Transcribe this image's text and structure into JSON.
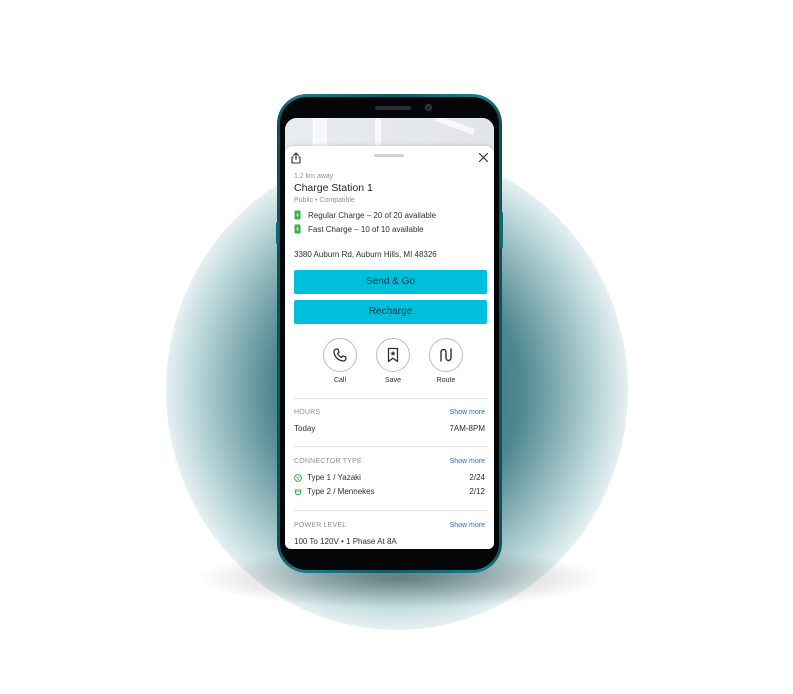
{
  "station": {
    "distance": "1.2 km away",
    "name": "Charge Station 1",
    "meta": "Public • Compatible",
    "availability": [
      {
        "label": "Regular Charge – 20 of 20 available"
      },
      {
        "label": "Fast Charge – 10 of 10 available"
      }
    ],
    "address": "3380 Auburn Rd, Auburn Hills, MI 48326"
  },
  "buttons": {
    "primary": "Send & Go",
    "secondary": "Recharge"
  },
  "actions": [
    {
      "label": "Call",
      "icon": "phone-icon"
    },
    {
      "label": "Save",
      "icon": "bookmark-star-icon"
    },
    {
      "label": "Route",
      "icon": "route-icon"
    }
  ],
  "hours": {
    "label": "HOURS",
    "show_more": "Show more",
    "day": "Today",
    "time": "7AM-8PM"
  },
  "connectors": {
    "label": "CONNECTOR TYPE",
    "show_more": "Show more",
    "items": [
      {
        "name": "Type 1 / Yazaki",
        "count": "2/24"
      },
      {
        "name": "Type 2 / Mennekes",
        "count": "2/12"
      }
    ]
  },
  "power": {
    "label": "POWER LEVEL",
    "show_more": "Show more",
    "value": "100 To 120V • 1 Phase At 8A"
  },
  "colors": {
    "accent": "#00bfdc",
    "link": "#1a73c9",
    "available_green": "#2fb34a",
    "phone_frame": "#0f5c66"
  }
}
